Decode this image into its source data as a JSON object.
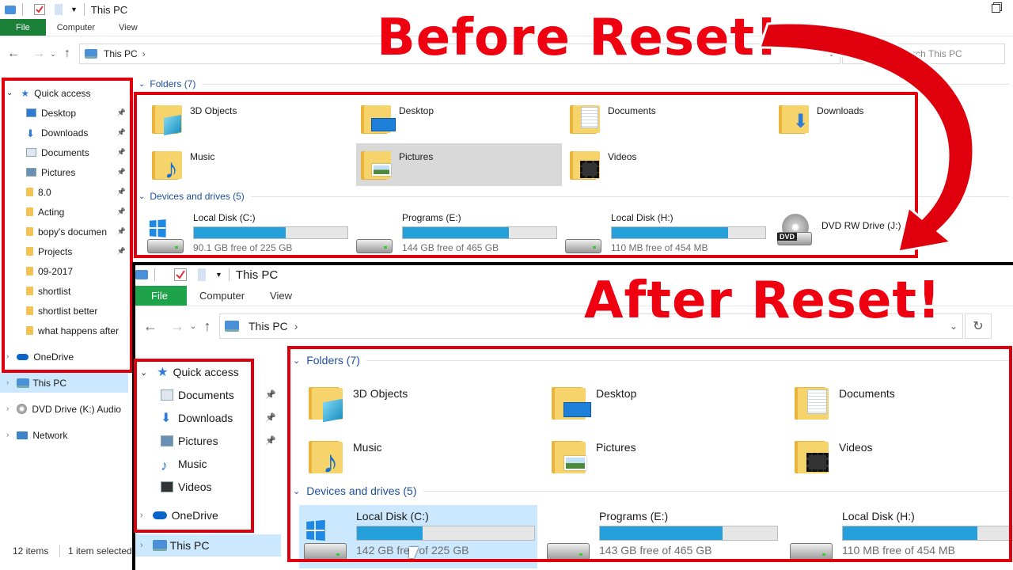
{
  "before": {
    "title": "This PC",
    "ribbon": {
      "file": "File",
      "computer": "Computer",
      "view": "View"
    },
    "address": "This PC",
    "search_placeholder": "Search This PC",
    "nav": {
      "quick_access": "Quick access",
      "items": [
        "Desktop",
        "Downloads",
        "Documents",
        "Pictures",
        "8.0",
        "Acting",
        "bopy's documen",
        "Projects",
        "09-2017",
        "shortlist",
        "shortlist better",
        "what happens after"
      ],
      "onedrive": "OneDrive",
      "this_pc": "This PC",
      "dvd": "DVD Drive (K:) Audio",
      "network": "Network"
    },
    "folders_header": "Folders (7)",
    "folders": [
      "3D Objects",
      "Desktop",
      "Documents",
      "Downloads",
      "Music",
      "Pictures",
      "Videos"
    ],
    "devices_header": "Devices and drives (5)",
    "drives": [
      {
        "name": "Local Disk (C:)",
        "free": "90.1 GB free of 225 GB",
        "used_fraction": 0.6
      },
      {
        "name": "Programs (E:)",
        "free": "144 GB free of 465 GB",
        "used_fraction": 0.69
      },
      {
        "name": "Local Disk (H:)",
        "free": "110 MB free of 454 MB",
        "used_fraction": 0.76
      }
    ],
    "dvd_drive": "DVD RW Drive (J:)",
    "dvd_badge": "DVD",
    "status": {
      "items": "12 items",
      "selected": "1 item selected"
    }
  },
  "after": {
    "title": "This PC",
    "ribbon": {
      "file": "File",
      "computer": "Computer",
      "view": "View"
    },
    "address": "This PC",
    "nav": {
      "quick_access": "Quick access",
      "items": [
        "Documents",
        "Downloads",
        "Pictures",
        "Music",
        "Videos"
      ],
      "onedrive": "OneDrive",
      "this_pc": "This PC"
    },
    "folders_header": "Folders (7)",
    "folders": [
      "3D Objects",
      "Desktop",
      "Documents",
      "Music",
      "Pictures",
      "Videos"
    ],
    "devices_header": "Devices and drives (5)",
    "drives": [
      {
        "name": "Local Disk (C:)",
        "free": "142 GB free of 225 GB",
        "used_fraction": 0.37
      },
      {
        "name": "Programs (E:)",
        "free": "143 GB free of 465 GB",
        "used_fraction": 0.69
      },
      {
        "name": "Local Disk (H:)",
        "free": "110 MB free of 454 MB",
        "used_fraction": 0.76
      }
    ]
  },
  "headlines": {
    "before": "Before Reset!",
    "after": "After Reset!"
  },
  "colors": {
    "highlight_box": "#e0000d",
    "headline": "#ee0010",
    "arrow": "#e0000d",
    "drive_bar": "#26a0da",
    "file_tab": "#1a7f37"
  },
  "icons": [
    "this-pc-icon",
    "star-icon",
    "pin-icon",
    "folder-icon",
    "cloud-icon",
    "network-icon",
    "dvd-icon",
    "refresh-icon",
    "search-icon",
    "back-arrow-icon",
    "forward-arrow-icon",
    "up-arrow-icon",
    "chevron-down-icon",
    "windows-logo-icon",
    "hdd-icon",
    "maximize-icon",
    "curved-arrow-icon"
  ]
}
